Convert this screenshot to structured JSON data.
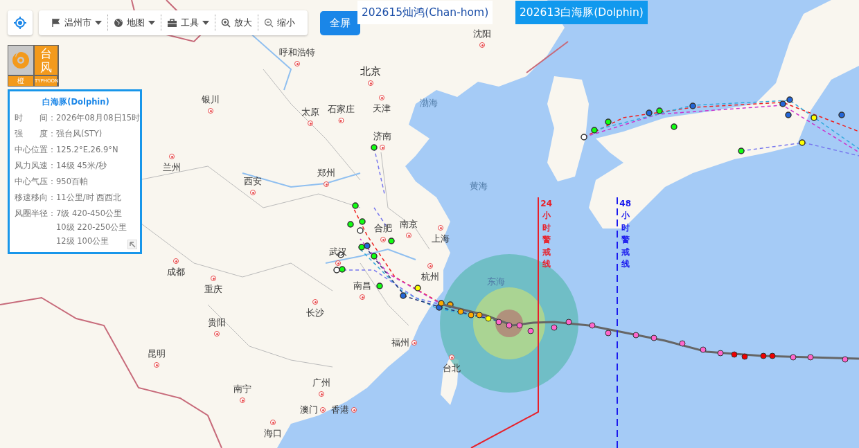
{
  "toolbar": {
    "items": [
      {
        "label": "温州市",
        "kind": "dropdown"
      },
      {
        "label": "地图",
        "kind": "dropdown"
      },
      {
        "label": "工具",
        "kind": "dropdown"
      },
      {
        "label": "放大",
        "kind": "button"
      },
      {
        "label": "缩小",
        "kind": "button"
      }
    ],
    "fullscreen": "全屏"
  },
  "tabs": [
    {
      "label": "202615灿鸿(Chan-hom)",
      "selected": false
    },
    {
      "label": "202613白海豚(Dolphin)",
      "selected": true
    }
  ],
  "warning_badge": {
    "title": "台风",
    "level": "橙",
    "caption": "TYPHOON"
  },
  "info_panel": {
    "title": "白海豚(Dolphin)",
    "rows": [
      {
        "label": "时　　间：",
        "values": [
          "2026年08月08日15时"
        ]
      },
      {
        "label": "强　　度：",
        "values": [
          "强台风(STY)"
        ]
      },
      {
        "label": "中心位置：",
        "values": [
          "125.2°E,26.9°N"
        ]
      },
      {
        "label": "风力风速：",
        "values": [
          "14级 45米/秒"
        ]
      },
      {
        "label": "中心气压：",
        "values": [
          "950百帕"
        ]
      },
      {
        "label": "移速移向：",
        "values": [
          "11公里/时 西西北"
        ]
      },
      {
        "label": "风圈半径：",
        "values": [
          "7级 420-450公里",
          "10级 220-250公里",
          "12级 100公里"
        ]
      }
    ]
  },
  "map": {
    "cities": [
      "沈阳",
      "呼和浩特",
      "北京",
      "银川",
      "太原",
      "石家庄",
      "天津",
      "济南",
      "兰州",
      "郑州",
      "西安",
      "合肥",
      "南京",
      "上海",
      "武汉",
      "成都",
      "杭州",
      "南昌",
      "重庆",
      "长沙",
      "贵阳",
      "福州",
      "台北",
      "昆明",
      "广州",
      "南宁",
      "澳门",
      "香港",
      "海口"
    ],
    "seas": [
      "渤海",
      "黄海",
      "东海"
    ]
  },
  "warning_lines": [
    {
      "label": "24小时警戒线",
      "kind": "solid",
      "color": "#e8202a"
    },
    {
      "label": "48小时警戒线",
      "kind": "dashed",
      "color": "#1a1aee"
    }
  ]
}
